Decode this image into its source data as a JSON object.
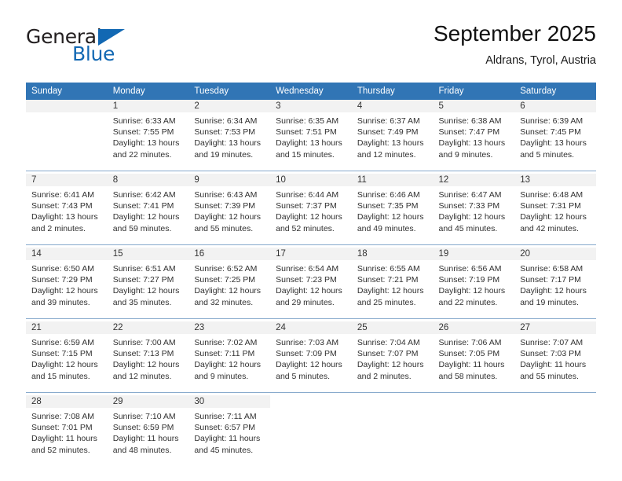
{
  "brand": {
    "name_part1": "General",
    "name_part2": "Blue",
    "flag_icon": "triangle-flag-icon",
    "accent_color": "#1268b3"
  },
  "header": {
    "month_title": "September 2025",
    "location": "Aldrans, Tyrol, Austria"
  },
  "theme": {
    "header_blue": "#3175b5",
    "daynum_band_gray": "#f2f2f2",
    "separator_blue": "#86a9cc"
  },
  "weekday_headers": [
    "Sunday",
    "Monday",
    "Tuesday",
    "Wednesday",
    "Thursday",
    "Friday",
    "Saturday"
  ],
  "weeks": [
    [
      {
        "day": "",
        "lines": []
      },
      {
        "day": "1",
        "lines": [
          "Sunrise: 6:33 AM",
          "Sunset: 7:55 PM",
          "Daylight: 13 hours",
          "and 22 minutes."
        ]
      },
      {
        "day": "2",
        "lines": [
          "Sunrise: 6:34 AM",
          "Sunset: 7:53 PM",
          "Daylight: 13 hours",
          "and 19 minutes."
        ]
      },
      {
        "day": "3",
        "lines": [
          "Sunrise: 6:35 AM",
          "Sunset: 7:51 PM",
          "Daylight: 13 hours",
          "and 15 minutes."
        ]
      },
      {
        "day": "4",
        "lines": [
          "Sunrise: 6:37 AM",
          "Sunset: 7:49 PM",
          "Daylight: 13 hours",
          "and 12 minutes."
        ]
      },
      {
        "day": "5",
        "lines": [
          "Sunrise: 6:38 AM",
          "Sunset: 7:47 PM",
          "Daylight: 13 hours",
          "and 9 minutes."
        ]
      },
      {
        "day": "6",
        "lines": [
          "Sunrise: 6:39 AM",
          "Sunset: 7:45 PM",
          "Daylight: 13 hours",
          "and 5 minutes."
        ]
      }
    ],
    [
      {
        "day": "7",
        "lines": [
          "Sunrise: 6:41 AM",
          "Sunset: 7:43 PM",
          "Daylight: 13 hours",
          "and 2 minutes."
        ]
      },
      {
        "day": "8",
        "lines": [
          "Sunrise: 6:42 AM",
          "Sunset: 7:41 PM",
          "Daylight: 12 hours",
          "and 59 minutes."
        ]
      },
      {
        "day": "9",
        "lines": [
          "Sunrise: 6:43 AM",
          "Sunset: 7:39 PM",
          "Daylight: 12 hours",
          "and 55 minutes."
        ]
      },
      {
        "day": "10",
        "lines": [
          "Sunrise: 6:44 AM",
          "Sunset: 7:37 PM",
          "Daylight: 12 hours",
          "and 52 minutes."
        ]
      },
      {
        "day": "11",
        "lines": [
          "Sunrise: 6:46 AM",
          "Sunset: 7:35 PM",
          "Daylight: 12 hours",
          "and 49 minutes."
        ]
      },
      {
        "day": "12",
        "lines": [
          "Sunrise: 6:47 AM",
          "Sunset: 7:33 PM",
          "Daylight: 12 hours",
          "and 45 minutes."
        ]
      },
      {
        "day": "13",
        "lines": [
          "Sunrise: 6:48 AM",
          "Sunset: 7:31 PM",
          "Daylight: 12 hours",
          "and 42 minutes."
        ]
      }
    ],
    [
      {
        "day": "14",
        "lines": [
          "Sunrise: 6:50 AM",
          "Sunset: 7:29 PM",
          "Daylight: 12 hours",
          "and 39 minutes."
        ]
      },
      {
        "day": "15",
        "lines": [
          "Sunrise: 6:51 AM",
          "Sunset: 7:27 PM",
          "Daylight: 12 hours",
          "and 35 minutes."
        ]
      },
      {
        "day": "16",
        "lines": [
          "Sunrise: 6:52 AM",
          "Sunset: 7:25 PM",
          "Daylight: 12 hours",
          "and 32 minutes."
        ]
      },
      {
        "day": "17",
        "lines": [
          "Sunrise: 6:54 AM",
          "Sunset: 7:23 PM",
          "Daylight: 12 hours",
          "and 29 minutes."
        ]
      },
      {
        "day": "18",
        "lines": [
          "Sunrise: 6:55 AM",
          "Sunset: 7:21 PM",
          "Daylight: 12 hours",
          "and 25 minutes."
        ]
      },
      {
        "day": "19",
        "lines": [
          "Sunrise: 6:56 AM",
          "Sunset: 7:19 PM",
          "Daylight: 12 hours",
          "and 22 minutes."
        ]
      },
      {
        "day": "20",
        "lines": [
          "Sunrise: 6:58 AM",
          "Sunset: 7:17 PM",
          "Daylight: 12 hours",
          "and 19 minutes."
        ]
      }
    ],
    [
      {
        "day": "21",
        "lines": [
          "Sunrise: 6:59 AM",
          "Sunset: 7:15 PM",
          "Daylight: 12 hours",
          "and 15 minutes."
        ]
      },
      {
        "day": "22",
        "lines": [
          "Sunrise: 7:00 AM",
          "Sunset: 7:13 PM",
          "Daylight: 12 hours",
          "and 12 minutes."
        ]
      },
      {
        "day": "23",
        "lines": [
          "Sunrise: 7:02 AM",
          "Sunset: 7:11 PM",
          "Daylight: 12 hours",
          "and 9 minutes."
        ]
      },
      {
        "day": "24",
        "lines": [
          "Sunrise: 7:03 AM",
          "Sunset: 7:09 PM",
          "Daylight: 12 hours",
          "and 5 minutes."
        ]
      },
      {
        "day": "25",
        "lines": [
          "Sunrise: 7:04 AM",
          "Sunset: 7:07 PM",
          "Daylight: 12 hours",
          "and 2 minutes."
        ]
      },
      {
        "day": "26",
        "lines": [
          "Sunrise: 7:06 AM",
          "Sunset: 7:05 PM",
          "Daylight: 11 hours",
          "and 58 minutes."
        ]
      },
      {
        "day": "27",
        "lines": [
          "Sunrise: 7:07 AM",
          "Sunset: 7:03 PM",
          "Daylight: 11 hours",
          "and 55 minutes."
        ]
      }
    ],
    [
      {
        "day": "28",
        "lines": [
          "Sunrise: 7:08 AM",
          "Sunset: 7:01 PM",
          "Daylight: 11 hours",
          "and 52 minutes."
        ]
      },
      {
        "day": "29",
        "lines": [
          "Sunrise: 7:10 AM",
          "Sunset: 6:59 PM",
          "Daylight: 11 hours",
          "and 48 minutes."
        ]
      },
      {
        "day": "30",
        "lines": [
          "Sunrise: 7:11 AM",
          "Sunset: 6:57 PM",
          "Daylight: 11 hours",
          "and 45 minutes."
        ]
      },
      {
        "day": "",
        "lines": []
      },
      {
        "day": "",
        "lines": []
      },
      {
        "day": "",
        "lines": []
      },
      {
        "day": "",
        "lines": []
      }
    ]
  ]
}
